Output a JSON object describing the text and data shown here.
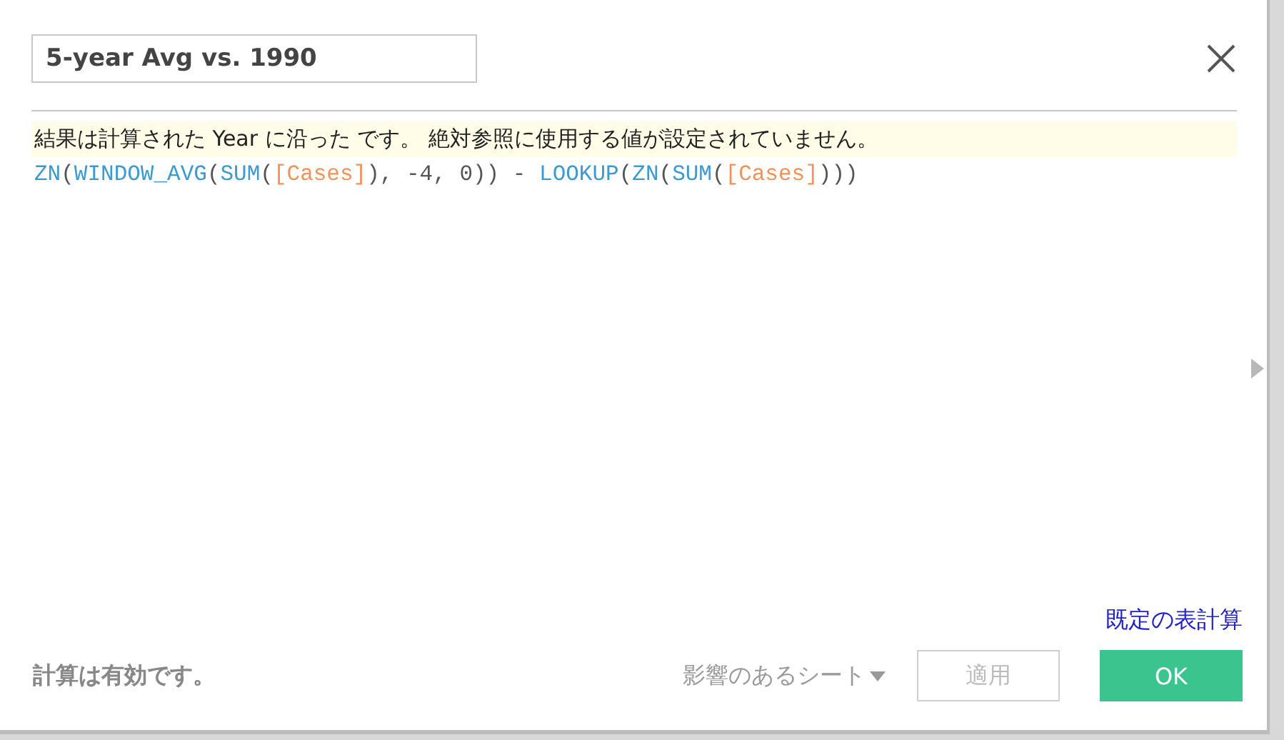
{
  "title_field": {
    "value": "5-year Avg vs. 1990"
  },
  "info_message": "結果は計算された Year に沿った です。 絶対参照に使用する値が設定されていません。",
  "formula": [
    {
      "kind": "function",
      "text": "ZN"
    },
    {
      "kind": "plain",
      "text": "("
    },
    {
      "kind": "function",
      "text": "WINDOW_AVG"
    },
    {
      "kind": "plain",
      "text": "("
    },
    {
      "kind": "function",
      "text": "SUM"
    },
    {
      "kind": "plain",
      "text": "("
    },
    {
      "kind": "field",
      "text": "[Cases]"
    },
    {
      "kind": "plain",
      "text": "), -4, 0)) - "
    },
    {
      "kind": "function",
      "text": "LOOKUP"
    },
    {
      "kind": "plain",
      "text": "("
    },
    {
      "kind": "function",
      "text": "ZN"
    },
    {
      "kind": "plain",
      "text": "("
    },
    {
      "kind": "function",
      "text": "SUM"
    },
    {
      "kind": "plain",
      "text": "("
    },
    {
      "kind": "field",
      "text": "[Cases]"
    },
    {
      "kind": "plain",
      "text": ")))"
    }
  ],
  "default_table_calc_link": "既定の表計算",
  "status": "計算は有効です。",
  "affected_sheets": {
    "label": "影響のあるシート"
  },
  "buttons": [
    {
      "kind": "secondary",
      "label": "適用",
      "disabled": true
    },
    {
      "kind": "primary",
      "label": "OK",
      "disabled": false
    }
  ]
}
